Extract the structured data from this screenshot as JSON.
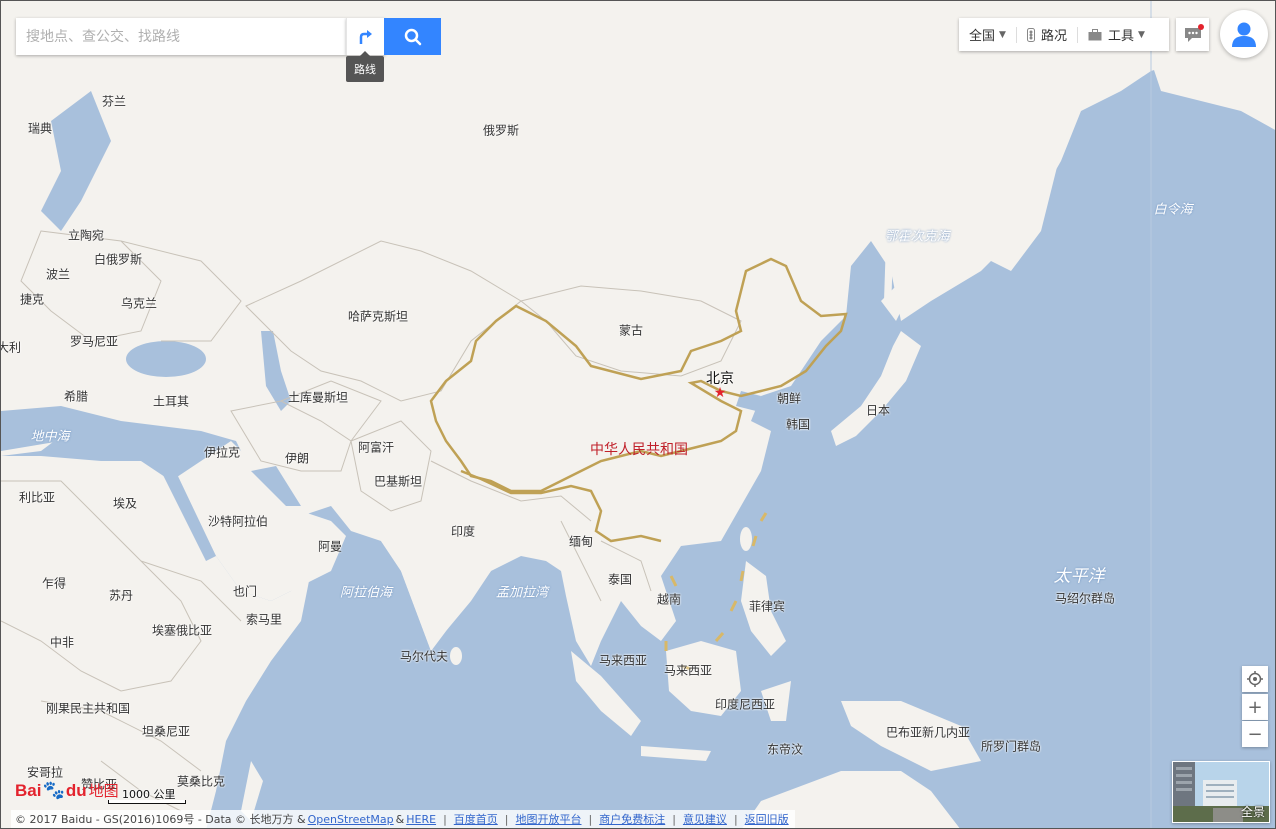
{
  "search": {
    "placeholder": "搜地点、查公交、找路线"
  },
  "route_tooltip": "路线",
  "toolbar": {
    "region_label": "全国",
    "traffic_label": "路况",
    "tools_label": "工具"
  },
  "countries": [
    {
      "id": "finland",
      "name": "芬兰"
    },
    {
      "id": "sweden",
      "name": "瑞典"
    },
    {
      "id": "russia",
      "name": "俄罗斯"
    },
    {
      "id": "lithuania",
      "name": "立陶宛"
    },
    {
      "id": "belarus",
      "name": "白俄罗斯"
    },
    {
      "id": "poland",
      "name": "波兰"
    },
    {
      "id": "czech",
      "name": "捷克"
    },
    {
      "id": "ukraine",
      "name": "乌克兰"
    },
    {
      "id": "romania",
      "name": "罗马尼亚"
    },
    {
      "id": "italy",
      "name": "大利"
    },
    {
      "id": "greece",
      "name": "希腊"
    },
    {
      "id": "turkey",
      "name": "土耳其"
    },
    {
      "id": "kazakhstan",
      "name": "哈萨克斯坦"
    },
    {
      "id": "mongolia",
      "name": "蒙古"
    },
    {
      "id": "turkmenistan",
      "name": "土库曼斯坦"
    },
    {
      "id": "iraq",
      "name": "伊拉克"
    },
    {
      "id": "iran",
      "name": "伊朗"
    },
    {
      "id": "afghanistan",
      "name": "阿富汗"
    },
    {
      "id": "pakistan",
      "name": "巴基斯坦"
    },
    {
      "id": "libya",
      "name": "利比亚"
    },
    {
      "id": "egypt",
      "name": "埃及"
    },
    {
      "id": "saudi",
      "name": "沙特阿拉伯"
    },
    {
      "id": "oman",
      "name": "阿曼"
    },
    {
      "id": "india",
      "name": "印度"
    },
    {
      "id": "myanmar",
      "name": "缅甸"
    },
    {
      "id": "thailand",
      "name": "泰国"
    },
    {
      "id": "vietnam",
      "name": "越南"
    },
    {
      "id": "philippines",
      "name": "菲律宾"
    },
    {
      "id": "north_korea",
      "name": "朝鲜"
    },
    {
      "id": "south_korea",
      "name": "韩国"
    },
    {
      "id": "japan",
      "name": "日本"
    },
    {
      "id": "chad",
      "name": "乍得"
    },
    {
      "id": "sudan",
      "name": "苏丹"
    },
    {
      "id": "yemen",
      "name": "也门"
    },
    {
      "id": "somalia",
      "name": "索马里"
    },
    {
      "id": "car",
      "name": "中非"
    },
    {
      "id": "ethiopia",
      "name": "埃塞俄比亚"
    },
    {
      "id": "maldives",
      "name": "马尔代夫"
    },
    {
      "id": "malaysia1",
      "name": "马来西亚"
    },
    {
      "id": "malaysia2",
      "name": "马来西亚"
    },
    {
      "id": "indonesia",
      "name": "印度尼西亚"
    },
    {
      "id": "drc",
      "name": "刚果民主共和国"
    },
    {
      "id": "tanzania",
      "name": "坦桑尼亚"
    },
    {
      "id": "angola",
      "name": "安哥拉"
    },
    {
      "id": "zambia",
      "name": "赞比亚"
    },
    {
      "id": "mozambique",
      "name": "莫桑比克"
    },
    {
      "id": "east_timor",
      "name": "东帝汶"
    },
    {
      "id": "png",
      "name": "巴布亚新几内亚"
    },
    {
      "id": "solomon",
      "name": "所罗门群岛"
    },
    {
      "id": "marshall",
      "name": "马绍尔群岛"
    }
  ],
  "seas": [
    {
      "id": "mediterranean",
      "name": "地中海"
    },
    {
      "id": "arabian_sea",
      "name": "阿拉伯海"
    },
    {
      "id": "bay_of_bengal",
      "name": "孟加拉湾"
    },
    {
      "id": "okhotsk",
      "name": "鄂霍次克海"
    },
    {
      "id": "bering",
      "name": "白令海"
    },
    {
      "id": "pacific",
      "name": "太平洋"
    }
  ],
  "china_label": "中华人民共和国",
  "capital_label": "北京",
  "capital_marker": "★",
  "panorama_label": "全景",
  "scale_label": "1000 公里",
  "logo": {
    "bai": "Bai",
    "paw": "🐾",
    "du": "du",
    "map": "地图"
  },
  "copyright": {
    "text": "© 2017 Baidu - GS(2016)1069号 - Data © 长地万方 &",
    "osm": "OpenStreetMap",
    "amp": "&",
    "here": "HERE",
    "links": [
      "百度首页",
      "地图开放平台",
      "商户免费标注",
      "意见建议",
      "返回旧版"
    ]
  }
}
